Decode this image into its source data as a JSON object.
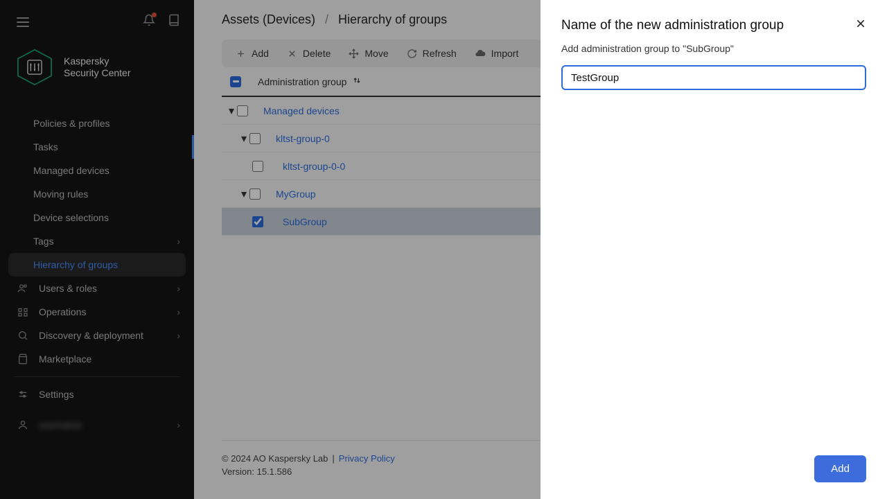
{
  "app": {
    "name_line1": "Kaspersky",
    "name_line2": "Security Center"
  },
  "sidebar": {
    "items": [
      {
        "label": "Policies & profiles"
      },
      {
        "label": "Tasks"
      },
      {
        "label": "Managed devices"
      },
      {
        "label": "Moving rules"
      },
      {
        "label": "Device selections"
      },
      {
        "label": "Tags"
      },
      {
        "label": "Hierarchy of groups"
      },
      {
        "label": "Users & roles"
      },
      {
        "label": "Operations"
      },
      {
        "label": "Discovery & deployment"
      },
      {
        "label": "Marketplace"
      },
      {
        "label": "Settings"
      },
      {
        "label": "username"
      }
    ]
  },
  "breadcrumb": {
    "part1": "Assets (Devices)",
    "sep": "/",
    "part2": "Hierarchy of groups"
  },
  "toolbar": {
    "add": "Add",
    "delete": "Delete",
    "move": "Move",
    "refresh": "Refresh",
    "import": "Import"
  },
  "table": {
    "header": "Administration group"
  },
  "tree": {
    "items": [
      {
        "label": "Managed devices",
        "depth": 0,
        "checked": false,
        "caret": true
      },
      {
        "label": "kltst-group-0",
        "depth": 1,
        "checked": false,
        "caret": true
      },
      {
        "label": "kltst-group-0-0",
        "depth": 2,
        "checked": false,
        "caret": false
      },
      {
        "label": "MyGroup",
        "depth": 1,
        "checked": false,
        "caret": true
      },
      {
        "label": "SubGroup",
        "depth": 2,
        "checked": true,
        "caret": false,
        "selected": true
      }
    ]
  },
  "footer": {
    "copyright": "© 2024 AO Kaspersky Lab",
    "sep": "|",
    "privacy": "Privacy Policy",
    "version_label": "Version:",
    "version": "15.1.586"
  },
  "panel": {
    "title": "Name of the new administration group",
    "subtitle": "Add administration group to \"SubGroup\"",
    "input_value": "TestGroup",
    "add_button": "Add"
  }
}
